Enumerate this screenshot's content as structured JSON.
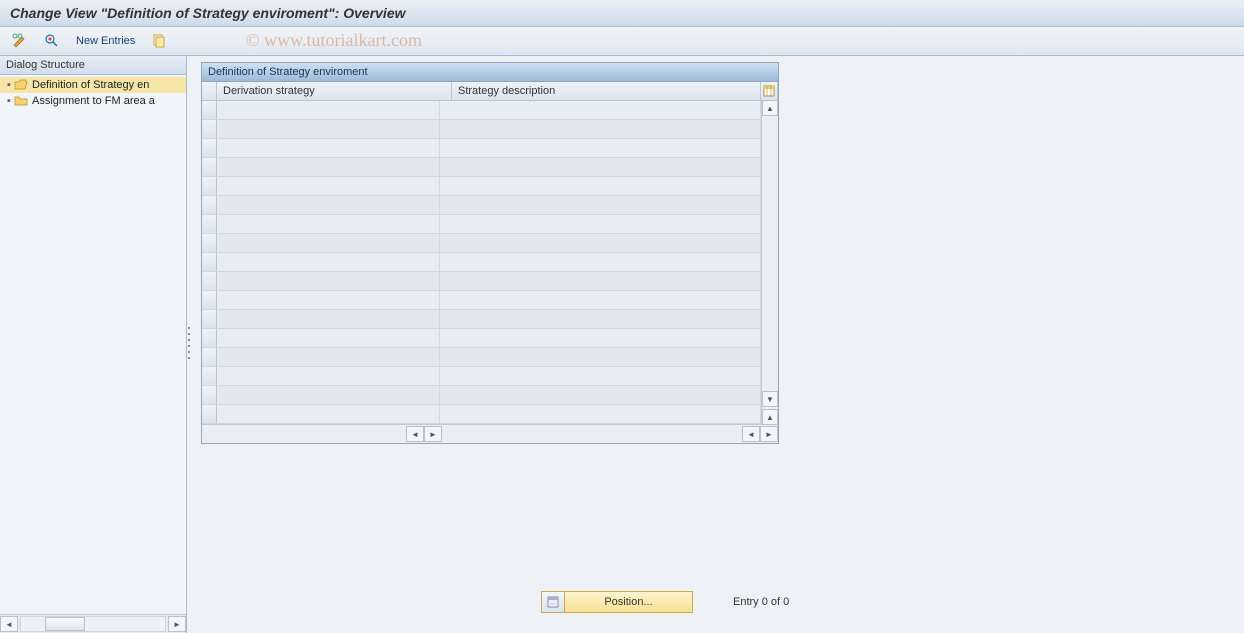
{
  "title": "Change View \"Definition of Strategy enviroment\": Overview",
  "toolbar": {
    "new_entries_label": "New Entries"
  },
  "sidebar": {
    "header": "Dialog Structure",
    "items": [
      {
        "label": "Definition of Strategy en",
        "selected": true,
        "open": true
      },
      {
        "label": "Assignment to FM area a",
        "selected": false,
        "open": false
      }
    ]
  },
  "panel": {
    "title": "Definition of Strategy enviroment",
    "columns": [
      "Derivation strategy",
      "Strategy description"
    ],
    "row_count": 17
  },
  "footer": {
    "position_label": "Position...",
    "entry_text": "Entry 0 of 0"
  },
  "watermark": "© www.tutorialkart.com"
}
